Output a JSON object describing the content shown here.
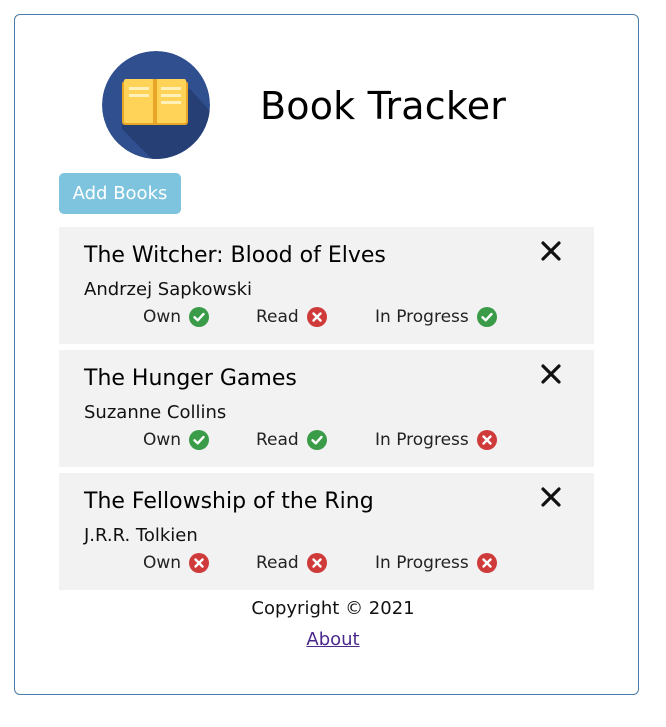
{
  "header": {
    "title": "Book Tracker",
    "logo_icon": "open-book-icon"
  },
  "toolbar": {
    "add_label": "Add Books"
  },
  "books": [
    {
      "title": "The Witcher: Blood of Elves",
      "author": "Andrzej Sapkowski",
      "own": true,
      "read": false,
      "in_progress": true
    },
    {
      "title": "The Hunger Games",
      "author": "Suzanne Collins",
      "own": true,
      "read": true,
      "in_progress": false
    },
    {
      "title": "The Fellowship of the Ring",
      "author": "J.R.R. Tolkien",
      "own": false,
      "read": false,
      "in_progress": false
    }
  ],
  "status_labels": {
    "own": "Own",
    "read": "Read",
    "in_progress": "In Progress"
  },
  "icons": {
    "delete": "close-icon",
    "yes": "check-circle-icon",
    "no": "x-circle-icon"
  },
  "colors": {
    "button": "#7ec4de",
    "check": "#3a9b48",
    "cross": "#cf3a3a",
    "card": "#f2f2f2",
    "border": "#4a7aa8"
  },
  "footer": {
    "copyright": "Copyright © 2021",
    "about_link": "About"
  }
}
